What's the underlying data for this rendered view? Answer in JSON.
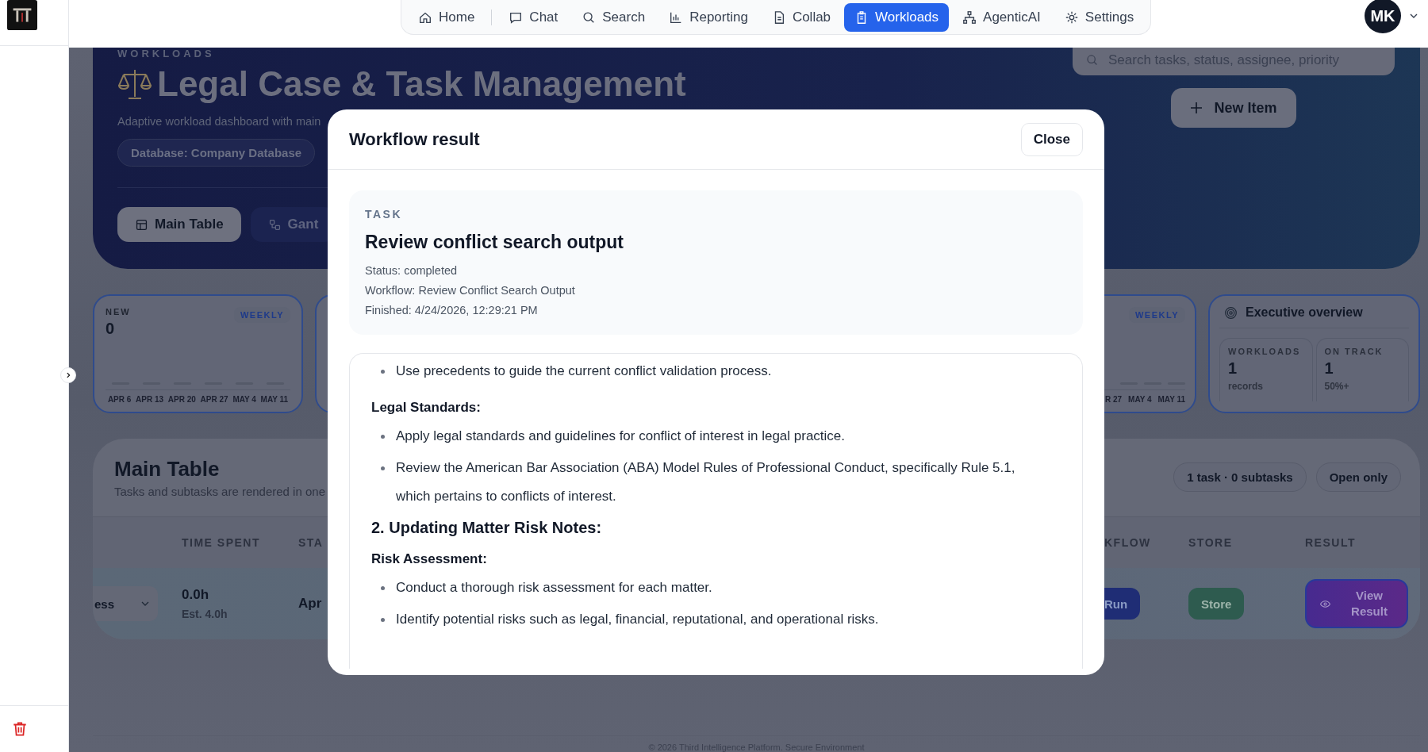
{
  "nav": {
    "items": [
      {
        "label": "Home",
        "selected": false
      },
      {
        "label": "Chat",
        "selected": false
      },
      {
        "label": "Search",
        "selected": false
      },
      {
        "label": "Reporting",
        "selected": false
      },
      {
        "label": "Collab",
        "selected": false
      },
      {
        "label": "Workloads",
        "selected": true
      },
      {
        "label": "AgenticAI",
        "selected": false
      },
      {
        "label": "Settings",
        "selected": false
      }
    ],
    "avatar": "MK"
  },
  "header": {
    "eyebrow": "WORKLOADS",
    "title": "Legal Case & Task Management",
    "subtitle": "Adaptive workload dashboard with main",
    "badge": "Database: Company Database",
    "search": {
      "placeholder": "Search tasks, status, assignee, priority"
    },
    "new_button": "New Item",
    "views": [
      {
        "label": "Main Table",
        "selected": true
      },
      {
        "label": "Gant",
        "selected": false
      }
    ]
  },
  "stat_cards": [
    {
      "label": "NEW",
      "value": "0",
      "period": "WEEKLY",
      "dates": [
        "APR 6",
        "APR 13",
        "APR 20",
        "APR 27",
        "MAY 4",
        "MAY 11"
      ]
    },
    {
      "period": "WEEKLY",
      "dates": [
        "R 27",
        "MAY 4",
        "MAY 11"
      ]
    }
  ],
  "overview": {
    "title": "Executive overview",
    "metrics": [
      {
        "label": "WORKLOADS",
        "value": "1",
        "note": "records"
      },
      {
        "label": "ON TRACK",
        "value": "1",
        "note": "50%+"
      }
    ]
  },
  "table": {
    "title": "Main Table",
    "subtitle": "Tasks and subtasks are rendered in one",
    "summary": "1 task · 0 subtasks",
    "filter": "Open only",
    "columns": [
      {
        "label": "TIME SPENT"
      },
      {
        "label": "STA"
      },
      {
        "label": "KFLOW"
      },
      {
        "label": "STORE"
      },
      {
        "label": "RESULT"
      }
    ],
    "row": {
      "status": "ess",
      "time_spent": "0.0h",
      "estimate": "Est. 4.0h",
      "start": "Apr",
      "workflow": "Run",
      "store": "Store",
      "result": "View Result"
    }
  },
  "footer": "© 2026 Third Intelligence Platform. Secure Environment",
  "modal": {
    "title": "Workflow result",
    "close": "Close",
    "task": {
      "label": "TASK",
      "title": "Review conflict search output",
      "details": [
        "Status: completed",
        "Workflow: Review Conflict Search Output",
        "Finished: 4/24/2026, 12:29:21 PM"
      ]
    },
    "content": [
      {
        "kind": "bullet",
        "text": "Use precedents to guide the current conflict validation process."
      },
      {
        "kind": "label",
        "text": "Legal Standards:"
      },
      {
        "kind": "bullet",
        "text": "Apply legal standards and guidelines for conflict of interest in legal practice."
      },
      {
        "kind": "bullet",
        "text": "Review the American Bar Association (ABA) Model Rules of Professional Conduct, specifically Rule 5.1, which pertains to conflicts of interest."
      },
      {
        "kind": "heading",
        "text": "2. Updating Matter Risk Notes:"
      },
      {
        "kind": "label",
        "text": "Risk Assessment:"
      },
      {
        "kind": "bullet",
        "text": "Conduct a thorough risk assessment for each matter."
      },
      {
        "kind": "bullet",
        "text": "Identify potential risks such as legal, financial, reputational, and operational risks."
      }
    ]
  }
}
